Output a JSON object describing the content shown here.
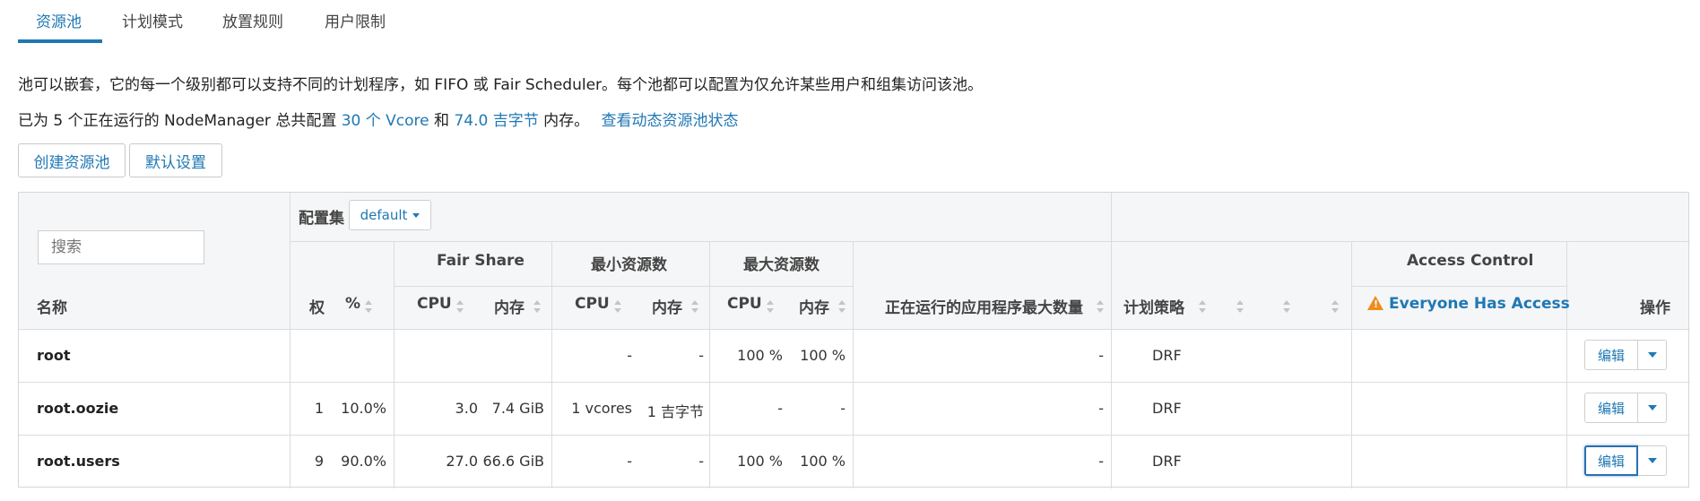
{
  "tabs": [
    {
      "label": "资源池"
    },
    {
      "label": "计划模式"
    },
    {
      "label": "放置规则"
    },
    {
      "label": "用户限制"
    }
  ],
  "description": "池可以嵌套，它的每一个级别都可以支持不同的计划程序，如 FIFO 或 Fair Scheduler。每个池都可以配置为仅允许某些用户和组集访问该池。",
  "summary": {
    "prefix": "已为 5 个正在运行的 NodeManager 总共配置",
    "vcore_link": "30 个 Vcore",
    "and": "和",
    "memory_link": "74.0 吉字节",
    "suffix": "内存。",
    "status_link": "查看动态资源池状态"
  },
  "actions": {
    "create": "创建资源池",
    "defaults": "默认设置"
  },
  "table": {
    "search_placeholder": "搜索",
    "config_set_label": "配置集",
    "config_set_value": "default",
    "headers": {
      "name": "名称",
      "weight": "权",
      "percent": "%",
      "fair_share": "Fair Share",
      "min_resources": "最小资源数",
      "max_resources": "最大资源数",
      "cpu": "CPU",
      "memory": "内存",
      "max_running_apps": "正在运行的应用程序最大数量",
      "schedule_policy": "计划策略",
      "access_control": "Access Control",
      "everyone_access": "Everyone Has Access",
      "actions": "操作"
    },
    "rows": [
      {
        "name": "root",
        "weight": "",
        "percent": "",
        "fs_cpu": "",
        "fs_mem": "",
        "min_cpu": "-",
        "min_mem": "-",
        "max_cpu": "100 %",
        "max_mem": "100 %",
        "max_apps": "-",
        "policy": "DRF",
        "edit": "编辑"
      },
      {
        "name": "root.oozie",
        "weight": "1",
        "percent": "10.0%",
        "fs_cpu": "3.0",
        "fs_mem": "7.4 GiB",
        "min_cpu": "1 vcores",
        "min_mem": "1 吉字节",
        "max_cpu": "-",
        "max_mem": "-",
        "max_apps": "-",
        "policy": "DRF",
        "edit": "编辑"
      },
      {
        "name": "root.users",
        "weight": "9",
        "percent": "90.0%",
        "fs_cpu": "27.0",
        "fs_mem": "66.6 GiB",
        "min_cpu": "-",
        "min_mem": "-",
        "max_cpu": "100 %",
        "max_mem": "100 %",
        "max_apps": "-",
        "policy": "DRF",
        "edit": "编辑"
      }
    ]
  },
  "colors": {
    "accent": "#1f78b4",
    "warning": "#ef8c1b"
  },
  "icons": [
    "warning-icon",
    "caret-down-icon",
    "sort-icon"
  ]
}
